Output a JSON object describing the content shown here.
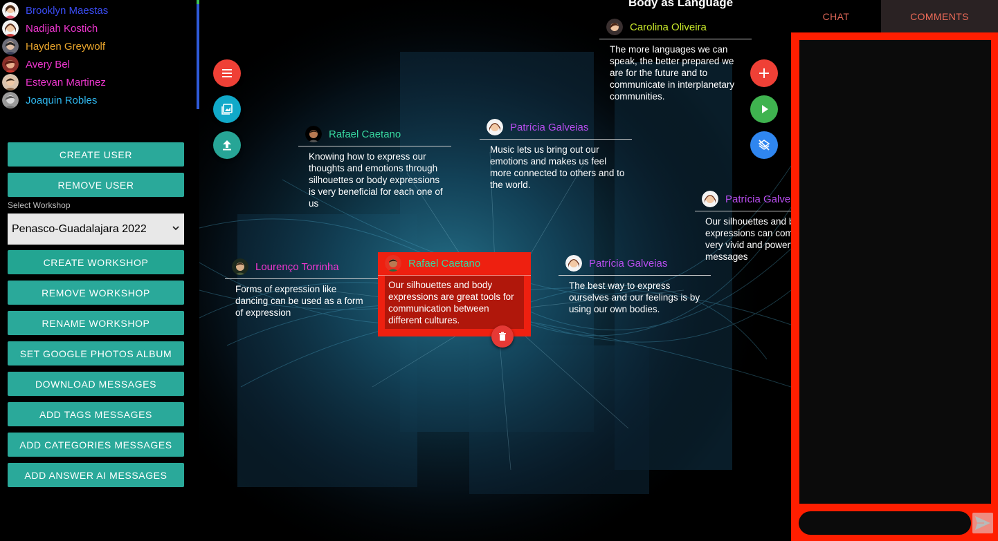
{
  "users": [
    {
      "name": "Brooklyn Maestas",
      "color": "#3a4cf2"
    },
    {
      "name": "Nadijah Kostich",
      "color": "#ef36cf"
    },
    {
      "name": "Hayden Greywolf",
      "color": "#e9a52c"
    },
    {
      "name": "Avery Bel",
      "color": "#ef36cf"
    },
    {
      "name": "Estevan Martinez",
      "color": "#ef36cf"
    },
    {
      "name": "Joaquin Robles",
      "color": "#2fb7ee"
    }
  ],
  "buttons": {
    "create_user": "CREATE USER",
    "remove_user": "REMOVE USER",
    "create_workshop": "CREATE WORKSHOP",
    "remove_workshop": "REMOVE WORKSHOP",
    "rename_workshop": "RENAME WORKSHOP",
    "set_google_photos_album": "SET GOOGLE PHOTOS ALBUM",
    "download_messages": "DOWNLOAD MESSAGES",
    "add_tags_messages": "ADD TAGS MESSAGES",
    "add_categories_messages": "ADD CATEGORIES MESSAGES",
    "add_answer_ai_messages": "ADD ANSWER AI MESSAGES"
  },
  "workshop": {
    "label": "Select Workshop",
    "selected": "Penasco-Guadalajara 2022"
  },
  "canvas": {
    "title": "Body as Language",
    "menu_icon": "menu-icon",
    "image_icon": "image-icon",
    "upload_icon": "upload-icon",
    "add_icon": "plus-icon",
    "play_icon": "play-icon",
    "layers_icon": "layers-off-icon"
  },
  "notes": [
    {
      "author": "Carolina Oliveira",
      "color": "#c8e82a",
      "text": "The more languages we can speak, the better prepared we are for the future and to communicate in interplanetary communities."
    },
    {
      "author": "Rafael Caetano",
      "color": "#37d8a0",
      "text": "Knowing how to express our thoughts and emotions through silhouettes or body expressions is very beneficial for each one of us"
    },
    {
      "author": "Patrícia Galveias",
      "color": "#b94ef0",
      "text": "Music lets us bring out our emotions and makes us feel more connected to others and to the world."
    },
    {
      "author": "Patrícia Galveias",
      "color": "#b94ef0",
      "text": "Our silhouettes and body expressions can communicate very vivid and powerful messages"
    },
    {
      "author": "Lourenço Torrinha",
      "color": "#ef36cf",
      "text": "Forms of expression like dancing can be used as a form of expression"
    },
    {
      "author": "Rafael Caetano",
      "color": "#37d8a0",
      "text": "Our silhouettes and body expressions are great tools for communication between different cultures."
    },
    {
      "author": "Patrícia Galveias",
      "color": "#b94ef0",
      "text": "The best way to express ourselves and our feelings is by using our own bodies."
    }
  ],
  "panel": {
    "tabs": [
      "CHAT",
      "COMMENTS"
    ],
    "active_tab": "COMMENTS",
    "comment_value": "",
    "send_icon": "send-icon"
  }
}
